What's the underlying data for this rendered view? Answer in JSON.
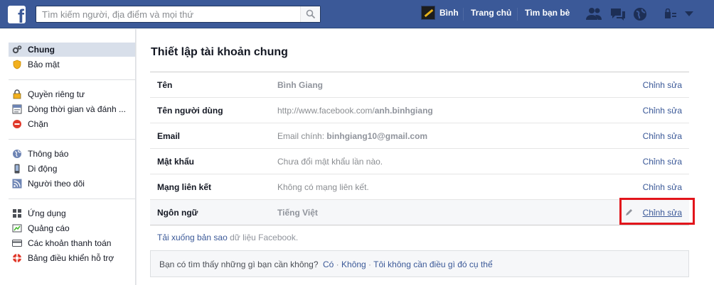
{
  "topbar": {
    "logo_letter": "f",
    "search_placeholder": "Tìm kiếm người, địa điểm và mọi thứ",
    "user_name": "Bình",
    "home_label": "Trang chủ",
    "find_friends_label": "Tìm bạn bè",
    "icons": [
      "friend-requests-icon",
      "messages-icon",
      "notifications-globe-icon",
      "privacy-shortcuts-icon",
      "account-menu-chevron-icon"
    ],
    "brand_color": "#3b5998"
  },
  "sidebar": {
    "items": [
      {
        "label": "Chung",
        "icon": "general-gears-icon"
      },
      {
        "label": "Bảo mật",
        "icon": "security-badge-icon"
      },
      {
        "label": "Quyền riêng tư",
        "icon": "privacy-lock-icon"
      },
      {
        "label": "Dòng thời gian và đánh ...",
        "icon": "timeline-icon"
      },
      {
        "label": "Chặn",
        "icon": "block-icon"
      },
      {
        "label": "Thông báo",
        "icon": "notifications-globe-icon"
      },
      {
        "label": "Di động",
        "icon": "mobile-phone-icon"
      },
      {
        "label": "Người theo dõi",
        "icon": "followers-rss-icon"
      },
      {
        "label": "Ứng dụng",
        "icon": "apps-grid-icon"
      },
      {
        "label": "Quảng cáo",
        "icon": "ads-icon"
      },
      {
        "label": "Các khoản thanh toán",
        "icon": "payment-card-icon"
      },
      {
        "label": "Bảng điều khiển hỗ trợ",
        "icon": "support-lifebuoy-icon"
      }
    ]
  },
  "main": {
    "title": "Thiết lập tài khoản chung",
    "rows": [
      {
        "label": "Tên",
        "value": "Bình Giang",
        "edit": "Chỉnh sửa"
      },
      {
        "label": "Tên người dùng",
        "value_prefix": "http://www.facebook.com/",
        "value_bold": "anh.binhgiang",
        "edit": "Chỉnh sửa"
      },
      {
        "label": "Email",
        "value_prefix": "Email chính: ",
        "value_bold": "binhgiang10@gmail.com",
        "edit": "Chỉnh sửa"
      },
      {
        "label": "Mật khẩu",
        "value": "Chưa đổi mật khẩu lần nào.",
        "edit": "Chỉnh sửa"
      },
      {
        "label": "Mạng liên kết",
        "value": "Không có mạng liên kết.",
        "edit": "Chỉnh sửa"
      },
      {
        "label": "Ngôn ngữ",
        "value": "Tiếng Việt",
        "edit": "Chỉnh sửa"
      }
    ],
    "download_link": "Tải xuống bản sao",
    "download_text": " dữ liệu Facebook.",
    "feedback_question": "Bạn có tìm thấy những gì bạn cần không?",
    "feedback_yes": "Có",
    "feedback_no": "Không",
    "feedback_other": "Tôi không cần điều gì đó cụ thể",
    "feedback_sep": " · ",
    "highlight_color": "#e2151b"
  }
}
